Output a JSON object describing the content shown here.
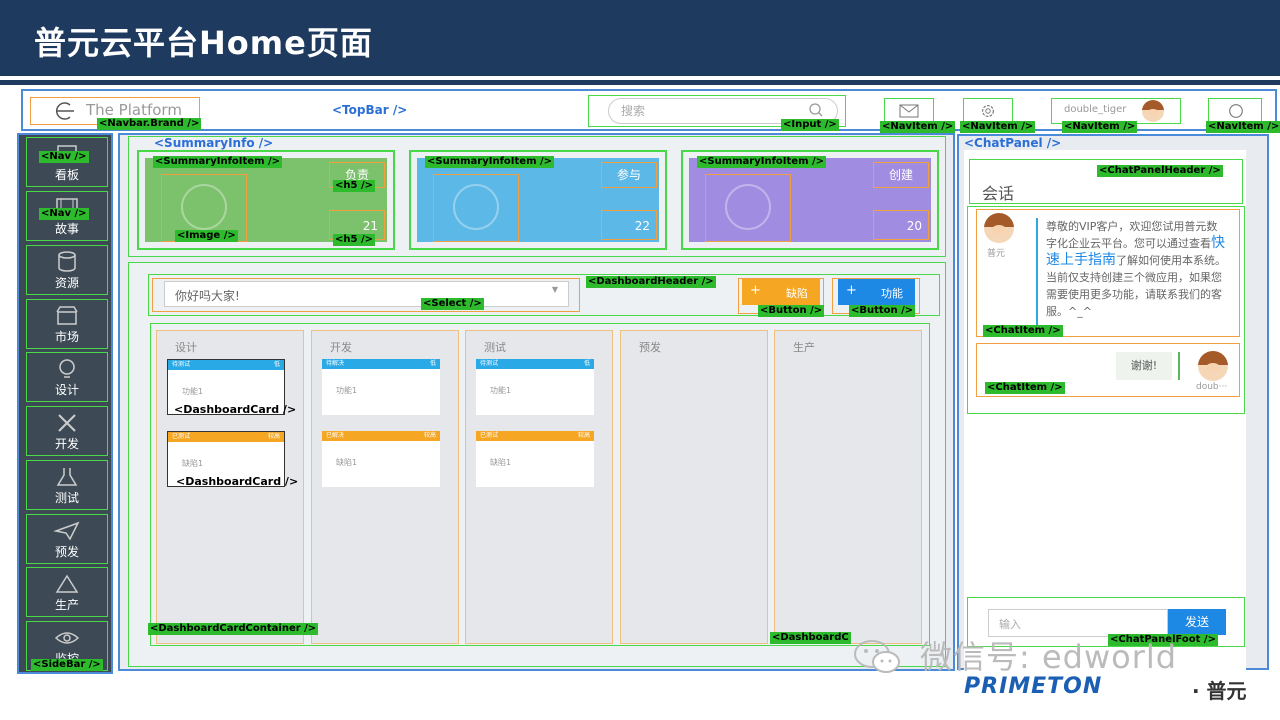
{
  "slide": {
    "title": "普元云平台Home页面"
  },
  "topbar": {
    "brand_text": "The Platform",
    "search_placeholder": "搜索",
    "user_name": "double_tiger"
  },
  "annotations": {
    "navbar_brand": "<Navbar.Brand />",
    "topbar": "<TopBar />",
    "input": "<Input />",
    "nav_item": "<NavItem />",
    "nav": "<Nav />",
    "sidebar": "<SideBar />",
    "summary_info": "<SummaryInfo />",
    "summary_info_item": "<SummaryInfoItem />",
    "h5": "<h5 />",
    "image": "<Image />",
    "dashboard_header": "<DashboardHeader />",
    "select": "<Select />",
    "button": "<Button />",
    "dashboard_card": "<DashboardCard />",
    "dashboard_card_container": "<DashboardCardContainer />",
    "dashboard_c": "<DashboardC",
    "chat_panel": "<ChatPanel />",
    "chat_panel_header": "<ChatPanelHeader />",
    "chat_item": "<ChatItem />",
    "chat_panel_footer": "<ChatPanelFoot />"
  },
  "sidebar": {
    "items": [
      {
        "label": "看板",
        "icon": "board-icon"
      },
      {
        "label": "故事",
        "icon": "film-icon"
      },
      {
        "label": "资源",
        "icon": "database-icon"
      },
      {
        "label": "市场",
        "icon": "store-icon"
      },
      {
        "label": "设计",
        "icon": "bulb-icon"
      },
      {
        "label": "开发",
        "icon": "tools-icon"
      },
      {
        "label": "测试",
        "icon": "flask-icon"
      },
      {
        "label": "预发",
        "icon": "plane-icon"
      },
      {
        "label": "生产",
        "icon": "triangle-icon"
      },
      {
        "label": "监控",
        "icon": "eye-icon"
      }
    ]
  },
  "summary": {
    "items": [
      {
        "label": "负责",
        "count": "21",
        "color": "#7cc16c"
      },
      {
        "label": "参与",
        "count": "22",
        "color": "#5cb8e6"
      },
      {
        "label": "创建",
        "count": "20",
        "color": "#a08ce0"
      }
    ]
  },
  "dashboard": {
    "select_value": "你好吗大家!",
    "buttons": [
      {
        "label": "缺陷",
        "color": "#f5a623"
      },
      {
        "label": "功能",
        "color": "#1e88e5"
      }
    ],
    "columns": [
      {
        "title": "设计",
        "cards": [
          {
            "status": "待测试",
            "priority": "低",
            "body": "功能1",
            "color": "#29a9e6"
          },
          {
            "status": "已测试",
            "priority": "较高",
            "body": "缺陷1",
            "color": "#f5a623"
          }
        ]
      },
      {
        "title": "开发",
        "cards": [
          {
            "status": "待解决",
            "priority": "低",
            "body": "功能1",
            "color": "#29a9e6"
          },
          {
            "status": "已解决",
            "priority": "较高",
            "body": "缺陷1",
            "color": "#f5a623"
          }
        ]
      },
      {
        "title": "测试",
        "cards": [
          {
            "status": "待测试",
            "priority": "低",
            "body": "功能1",
            "color": "#29a9e6"
          },
          {
            "status": "已测试",
            "priority": "较高",
            "body": "缺陷1",
            "color": "#f5a623"
          }
        ]
      },
      {
        "title": "预发",
        "cards": []
      },
      {
        "title": "生产",
        "cards": []
      }
    ]
  },
  "chat": {
    "title": "会话",
    "messages": [
      {
        "sender": "普元",
        "text_a": "尊敬的VIP客户，欢迎您试用普元数字化企业云平台。您可以通过查看",
        "link": "快速上手指南",
        "text_b": "了解如何使用本系统。当前仅支持创建三个微应用，如果您需要使用更多功能，请联系我们的客服。^_^"
      },
      {
        "sender": "doub···",
        "text": "谢谢!"
      }
    ],
    "input_placeholder": "输入",
    "send_label": "发送"
  },
  "footer": {
    "watermark": "微信号: edworld",
    "brand": "PRIMETON",
    "brand_cn": "· 普元"
  }
}
